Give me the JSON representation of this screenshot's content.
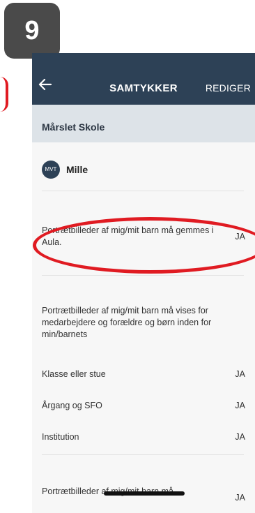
{
  "step_badge": "9",
  "header": {
    "title": "SAMTYKKER",
    "edit_label": "REDIGER",
    "back_icon": "arrow-left-icon",
    "bar_color": "#2d4156"
  },
  "school": "Mårslet Skole",
  "child": {
    "initials": "MVT",
    "name": "Mille"
  },
  "consents": {
    "storage": {
      "text": "Portrætbilleder af mig/mit barn må gemmes i Aula.",
      "value": "JA"
    },
    "sharing": {
      "text": "Portrætbilleder af mig/mit barn må vises for medarbejdere og forældre og børn inden for min/barnets",
      "options": [
        {
          "label": "Klasse eller stue",
          "value": "JA"
        },
        {
          "label": "Årgang og SFO",
          "value": "JA"
        },
        {
          "label": "Institution",
          "value": "JA"
        }
      ]
    },
    "partial": {
      "text": "Portrætbilleder af mig/mit barn må",
      "value": "JA"
    }
  },
  "annotation_color": "#e01b22"
}
